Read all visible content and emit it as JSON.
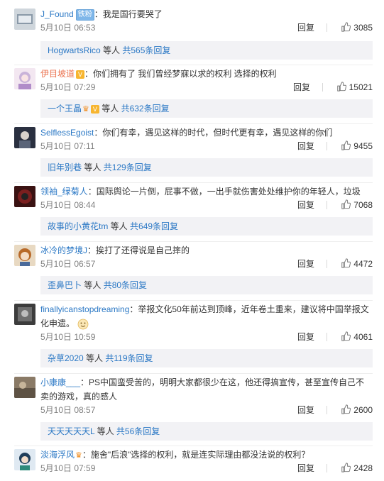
{
  "top_fragment": "▪▪▪▪▪ ▪▪ ▪▪▪▪",
  "comments": [
    {
      "user": "J_Found",
      "badge": "铁粉",
      "text": "：我是国行要哭了",
      "time": "5月10日 06:53",
      "reply": "回复",
      "likes": "3085",
      "sub_user": "HogwartsRico",
      "sub_etc": " 等人 ",
      "sub_more": "共565条回复"
    },
    {
      "user": "伊目坡道",
      "text": "：你们拥有了 我们曾经梦寐以求的权利 选择的权利",
      "time": "5月10日 07:29",
      "reply": "回复",
      "likes": "15021",
      "sub_user": "一个王晶",
      "sub_etc": " 等人 ",
      "sub_more": "共632条回复"
    },
    {
      "user": "SelflessEgoist",
      "text": "：你们有幸，遇见这样的时代，但时代更有幸，遇见这样的你们",
      "time": "5月10日 07:11",
      "reply": "回复",
      "likes": "9455",
      "sub_user": "旧年别巷",
      "sub_etc": " 等人 ",
      "sub_more": "共129条回复"
    },
    {
      "user": "领袖_绿菊人",
      "text": "：国际舆论一片倒，屁事不做，一出手就伤害处处维护你的年轻人，垃圾",
      "time": "5月10日 08:44",
      "reply": "回复",
      "likes": "7068",
      "sub_user": "故事的小黄花tm",
      "sub_etc": " 等人 ",
      "sub_more": "共649条回复"
    },
    {
      "user": "冰冷的梦境J",
      "text": "：挨打了还得说是自己摔的",
      "time": "5月10日 06:57",
      "reply": "回复",
      "likes": "4472",
      "sub_user": "歪鼻巴卜",
      "sub_etc": " 等人 ",
      "sub_more": "共80条回复"
    },
    {
      "user": "finallyicanstopdreaming",
      "text": "：举报文化50年前达到顶峰，近年卷土重来，建议将中国举报文化申遗。",
      "time": "5月10日 10:59",
      "reply": "回复",
      "likes": "4061",
      "sub_user": "杂草2020",
      "sub_etc": " 等人 ",
      "sub_more": "共119条回复"
    },
    {
      "user": "小康康___",
      "text": "：PS中国蛮受苦的，明明大家都很少在这，他还得搞宣传，甚至宣传自己不卖的游戏，真的感人",
      "time": "5月10日 08:57",
      "reply": "回复",
      "likes": "2600",
      "sub_user": "天天天天天L",
      "sub_etc": " 等人 ",
      "sub_more": "共56条回复"
    },
    {
      "user": "淡海浮风",
      "text": "：施舍\"后浪\"选择的权利，就是连实际理由都没法说的权利？",
      "time": "5月10日 07:59",
      "reply": "回复",
      "likes": "2428"
    }
  ],
  "icons": {
    "like": "thumbs-up-icon",
    "vip": "vip-icon",
    "crown": "crown-icon",
    "emoji": "smiley-emoji-icon"
  },
  "colors": {
    "username": "#eb7350",
    "link_blue": "#2b78c5",
    "meta_gray": "#808080",
    "sub_bg": "#f2f2f5"
  }
}
